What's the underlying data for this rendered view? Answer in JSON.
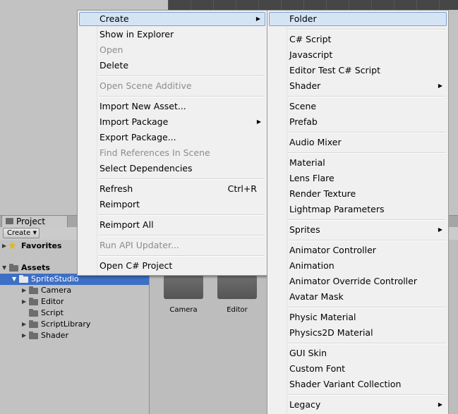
{
  "project_panel": {
    "tab_label": "Project",
    "create_button": "Create",
    "tree": {
      "favorites": "Favorites",
      "assets": "Assets",
      "sprite_studio": "SpriteStudio",
      "children": [
        "Camera",
        "Editor",
        "Script",
        "ScriptLibrary",
        "Shader"
      ]
    },
    "grid_items": [
      "Camera",
      "Editor"
    ]
  },
  "context_menu": {
    "items": [
      {
        "label": "Create"
      },
      {
        "label": "Show in Explorer"
      },
      {
        "label": "Open"
      },
      {
        "label": "Delete"
      },
      {
        "label": "Open Scene Additive"
      },
      {
        "label": "Import New Asset..."
      },
      {
        "label": "Import Package"
      },
      {
        "label": "Export Package..."
      },
      {
        "label": "Find References In Scene"
      },
      {
        "label": "Select Dependencies"
      },
      {
        "label": "Refresh",
        "shortcut": "Ctrl+R"
      },
      {
        "label": "Reimport"
      },
      {
        "label": "Reimport All"
      },
      {
        "label": "Run API Updater..."
      },
      {
        "label": "Open C# Project"
      }
    ]
  },
  "create_submenu": {
    "items": [
      "Folder",
      "C# Script",
      "Javascript",
      "Editor Test C# Script",
      "Shader",
      "Scene",
      "Prefab",
      "Audio Mixer",
      "Material",
      "Lens Flare",
      "Render Texture",
      "Lightmap Parameters",
      "Sprites",
      "Animator Controller",
      "Animation",
      "Animator Override Controller",
      "Avatar Mask",
      "Physic Material",
      "Physics2D Material",
      "GUI Skin",
      "Custom Font",
      "Shader Variant Collection",
      "Legacy"
    ]
  },
  "icons": {
    "submenu_arrow": "▶",
    "favorites_star": "★",
    "tree_expanded": "▼",
    "tree_collapsed": "▶",
    "dropdown_caret": "▼"
  }
}
